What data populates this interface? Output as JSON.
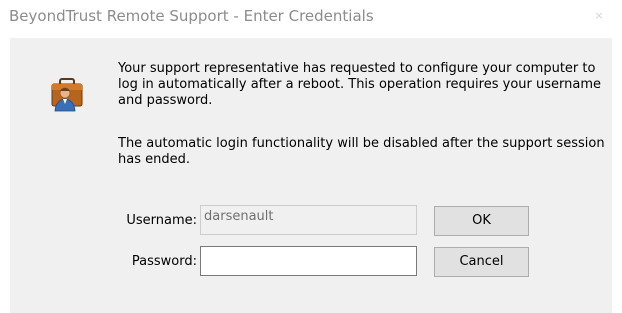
{
  "window": {
    "title": "BeyondTrust Remote Support - Enter Credentials",
    "close_glyph": "×"
  },
  "icon": {
    "name": "user-briefcase-icon"
  },
  "message": {
    "paragraph1": "Your support representative has requested to configure your computer to log in automatically after a reboot.  This operation requires your username and password.",
    "paragraph2": "The automatic login functionality will be disabled after the support session has ended."
  },
  "form": {
    "username_label": "Username:",
    "username_value": "darsenault",
    "password_label": "Password:",
    "password_value": ""
  },
  "buttons": {
    "ok_label": "OK",
    "cancel_label": "Cancel"
  },
  "colors": {
    "client_background": "#f0f0f0",
    "title_text": "#8c8c8c",
    "button_face": "#e1e1e1"
  }
}
